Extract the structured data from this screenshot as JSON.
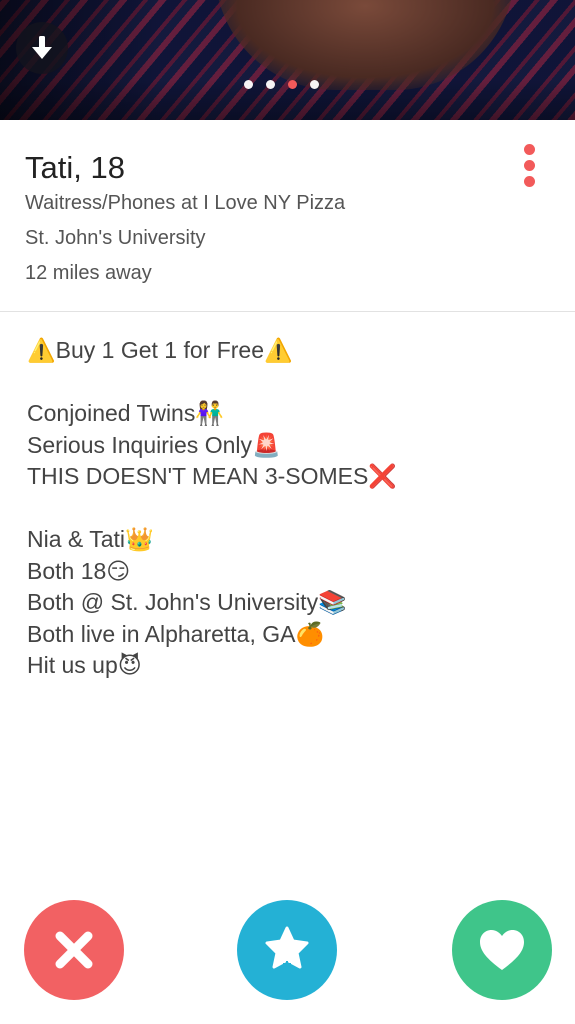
{
  "photo": {
    "page_count": 4,
    "active_page": 3
  },
  "profile": {
    "name_age": "Tati, 18",
    "job": "Waitress/Phones at I Love NY Pizza",
    "school": "St. John's University",
    "distance": "12 miles away"
  },
  "bio": {
    "line1": "⚠️Buy 1 Get 1 for Free⚠️",
    "line2": "Conjoined Twins👫",
    "line3": "Serious Inquiries Only🚨",
    "line4": "THIS DOESN'T MEAN 3-SOMES❌",
    "line5": "Nia & Tati👑",
    "line6": "Both 18😏",
    "line7": "Both @ St. John's University📚",
    "line8": "Both live in Alpharetta, GA🍊",
    "line9": "Hit us up😈"
  },
  "colors": {
    "accent": "#f25a5a",
    "nope": "#f26163",
    "super_like": "#24b1d5",
    "like": "#3fc58a"
  },
  "icons": {
    "download": "arrow-down-icon",
    "more": "more-vertical-icon",
    "nope": "x-icon",
    "super_like": "star-icon",
    "like": "heart-icon"
  }
}
